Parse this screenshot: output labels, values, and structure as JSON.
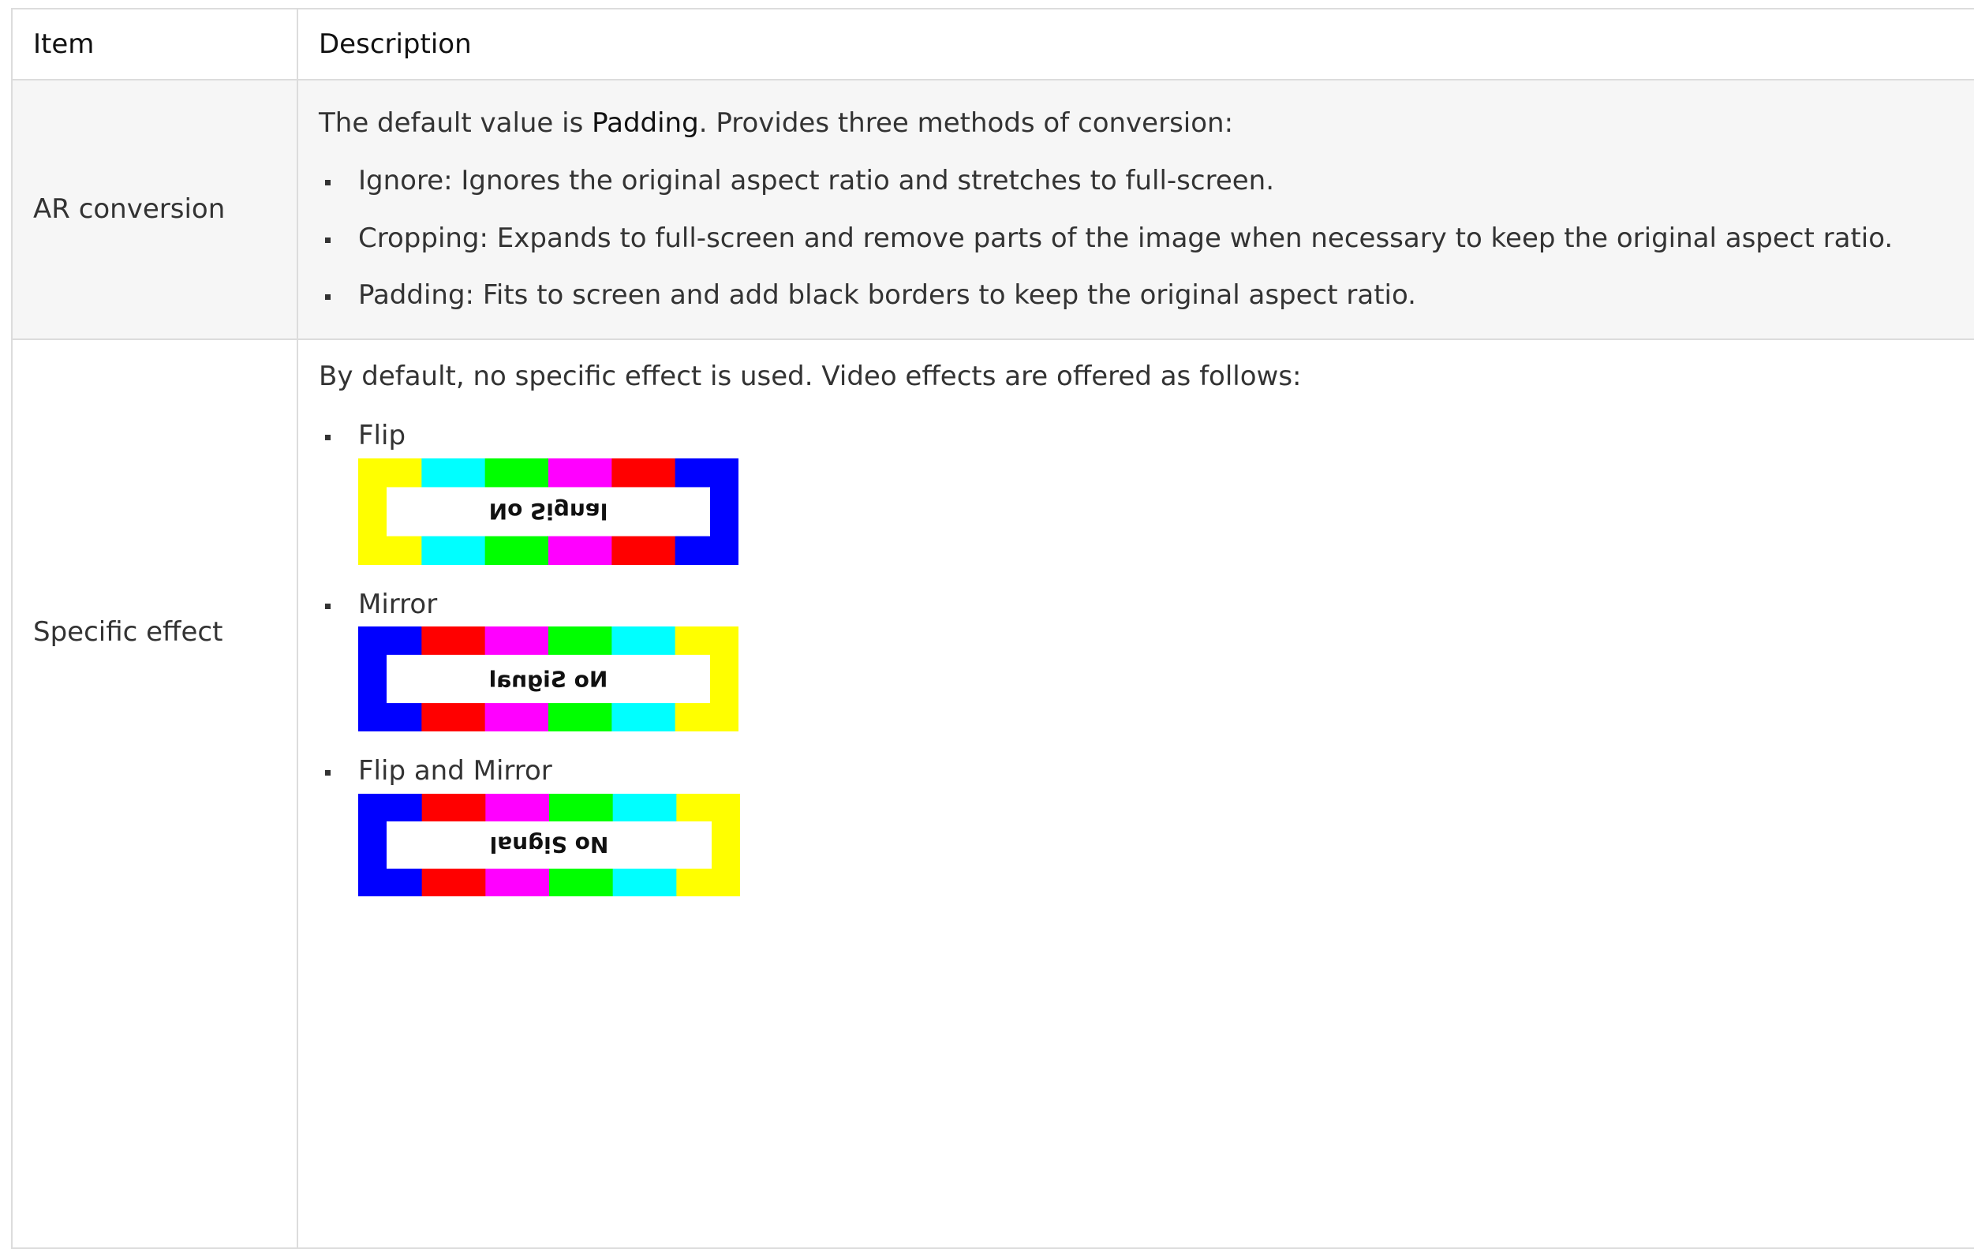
{
  "header": {
    "item": "Item",
    "description": "Description"
  },
  "rows": [
    {
      "item": "AR conversion",
      "intro_prefix": "The default value is ",
      "intro_bold": "Padding",
      "intro_suffix": ". Provides three methods of conversion:",
      "bullets": [
        "Ignore: Ignores the original aspect ratio and stretches to full-screen.",
        "Cropping: Expands to full-screen and remove parts of the image when necessary to keep the original aspect ratio.",
        "Padding: Fits to screen and add black borders to keep the original aspect ratio."
      ]
    },
    {
      "item": "Specific effect",
      "intro": "By default, no specific effect is used. Video effects are offered as follows:",
      "effects": [
        {
          "label": "Flip",
          "image_text": "No Signal",
          "bar_colors": [
            "#ffff00",
            "#00ffff",
            "#00ff00",
            "#ff00ff",
            "#ff0000",
            "#0000ff"
          ],
          "transform": "flip"
        },
        {
          "label": "Mirror",
          "image_text": "No Signal",
          "bar_colors": [
            "#0000ff",
            "#ff0000",
            "#ff00ff",
            "#00ff00",
            "#00ffff",
            "#ffff00"
          ],
          "transform": "mirror"
        },
        {
          "label": "Flip and Mirror",
          "image_text": "No Signal",
          "bar_colors": [
            "#0000ff",
            "#ff0000",
            "#ff00ff",
            "#00ff00",
            "#00ffff",
            "#ffff00"
          ],
          "transform": "flip-mirror"
        }
      ]
    }
  ]
}
